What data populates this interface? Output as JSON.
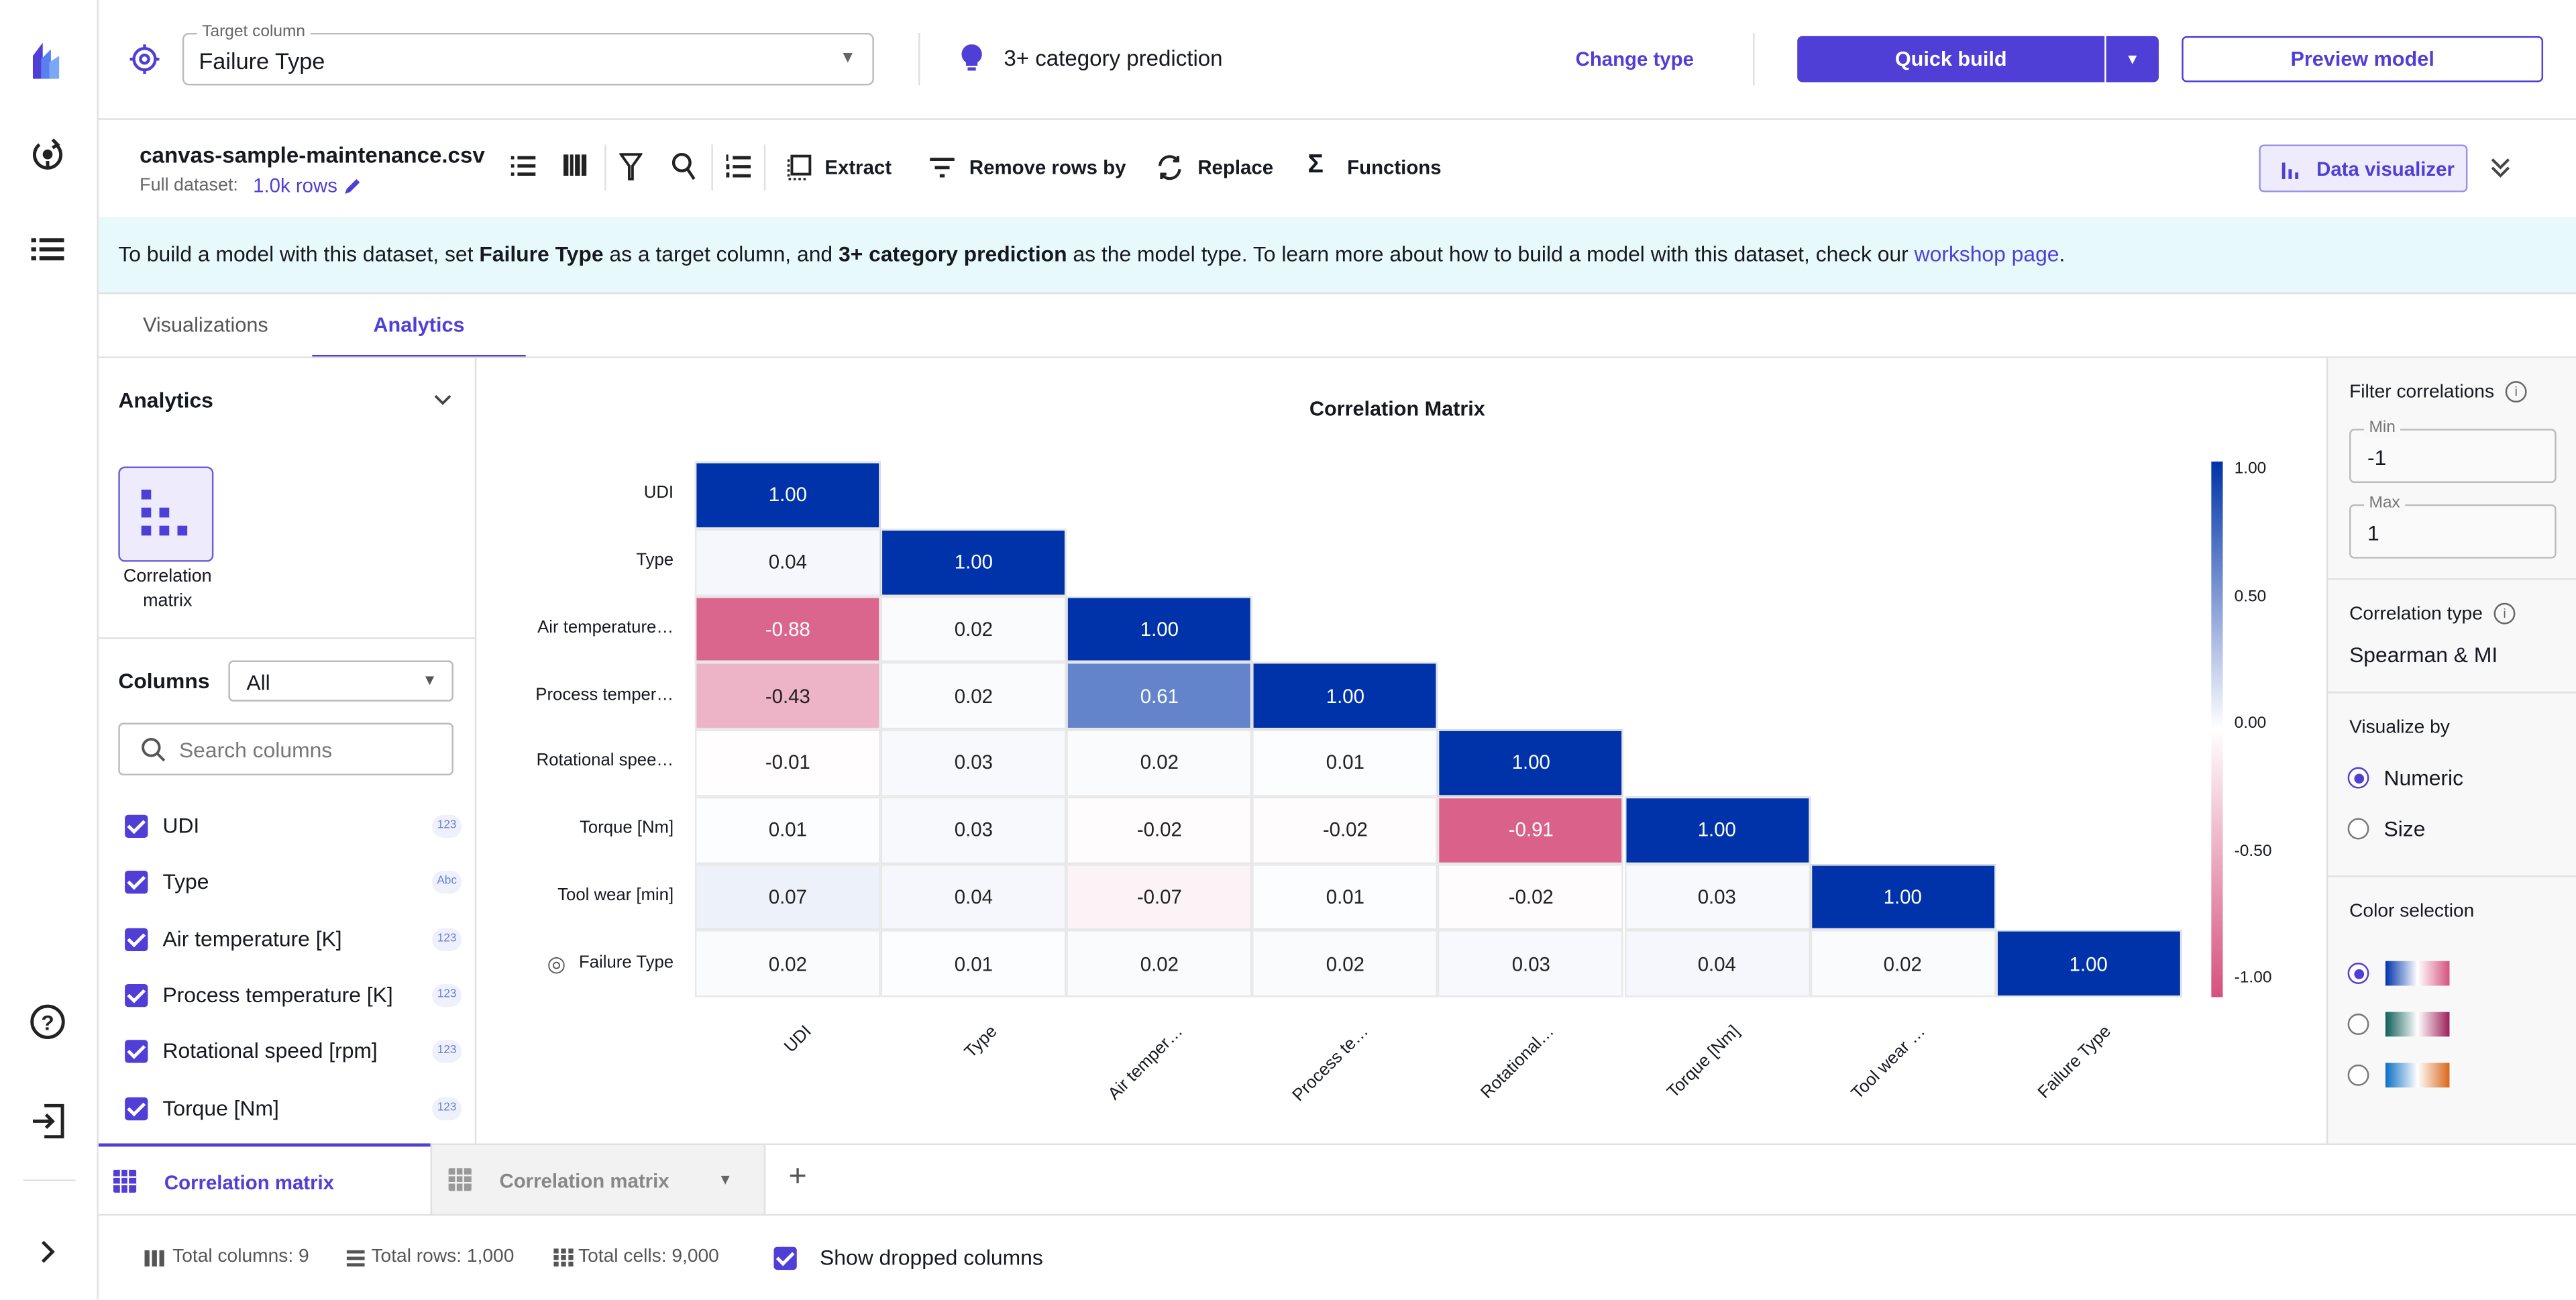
{
  "header": {
    "target_label": "Target column",
    "target_value": "Failure Type",
    "model_type": "3+ category prediction",
    "change_type": "Change type",
    "quick_build": "Quick build",
    "preview_model": "Preview model"
  },
  "toolbar": {
    "filename": "canvas-sample-maintenance.csv",
    "dataset_label": "Full dataset:",
    "rows_link": "1.0k rows",
    "extract": "Extract",
    "remove_rows": "Remove rows by",
    "replace": "Replace",
    "functions": "Functions",
    "data_visualizer": "Data visualizer"
  },
  "banner": {
    "p1": "To build a model with this dataset, set ",
    "b1": "Failure Type",
    "p2": " as a target column, and ",
    "b2": "3+ category prediction",
    "p3": " as the model type. To learn more about how to build a model with this dataset, check our ",
    "link": "workshop page",
    "p4": "."
  },
  "tabs": [
    {
      "label": "Visualizations"
    },
    {
      "label": "Analytics",
      "active": true
    }
  ],
  "left_panel": {
    "title": "Analytics",
    "card_label": "Correlation matrix",
    "columns_label": "Columns",
    "columns_filter": "All",
    "search_placeholder": "Search columns",
    "columns": [
      {
        "name": "UDI",
        "type": "123"
      },
      {
        "name": "Type",
        "type": "Abc"
      },
      {
        "name": "Air temperature [K]",
        "type": "123"
      },
      {
        "name": "Process temperature [K]",
        "type": "123"
      },
      {
        "name": "Rotational speed [rpm]",
        "type": "123"
      },
      {
        "name": "Torque [Nm]",
        "type": "123"
      }
    ]
  },
  "right_panel": {
    "filter_title": "Filter correlations",
    "min_label": "Min",
    "min_value": "-1",
    "max_label": "Max",
    "max_value": "1",
    "corr_type_title": "Correlation type",
    "corr_type_value": "Spearman & MI",
    "visualize_title": "Visualize by",
    "visualize_options": [
      "Numeric",
      "Size"
    ],
    "visualize_selected": "Numeric",
    "color_title": "Color selection",
    "color_schemes": [
      [
        "#0033aa",
        "#ffffff",
        "#d6517d"
      ],
      [
        "#0f5e58",
        "#ffffff",
        "#9c1f5a"
      ],
      [
        "#0b6fc4",
        "#ffffff",
        "#d9661a"
      ]
    ],
    "color_selected": 0
  },
  "chart_data": {
    "type": "heatmap",
    "title": "Correlation Matrix",
    "row_labels": [
      "UDI",
      "Type",
      "Air temperature…",
      "Process temper…",
      "Rotational spee…",
      "Torque [Nm]",
      "Tool wear [min]",
      "Failure Type"
    ],
    "col_labels": [
      "UDI",
      "Type",
      "Air temper…",
      "Process te…",
      "Rotational…",
      "Torque [Nm]",
      "Tool wear …",
      "Failure Type"
    ],
    "values": [
      [
        1.0
      ],
      [
        0.04,
        1.0
      ],
      [
        -0.88,
        0.02,
        1.0
      ],
      [
        -0.43,
        0.02,
        0.61,
        1.0
      ],
      [
        -0.01,
        0.03,
        0.02,
        0.01,
        1.0
      ],
      [
        0.01,
        0.03,
        -0.02,
        -0.02,
        -0.91,
        1.0
      ],
      [
        0.07,
        0.04,
        -0.07,
        0.01,
        -0.02,
        0.03,
        1.0
      ],
      [
        0.02,
        0.01,
        0.02,
        0.02,
        0.03,
        0.04,
        0.02,
        1.0
      ]
    ],
    "colorbar_ticks": [
      "1.00",
      "0.50",
      "0.00",
      "-0.50",
      "-1.00"
    ],
    "range": [
      -1,
      1
    ],
    "colors": {
      "positive": "#0033aa",
      "zero": "#ffffff",
      "negative": "#d6517d"
    }
  },
  "bottom_tabs": [
    {
      "label": "Correlation matrix",
      "active": true
    },
    {
      "label": "Correlation matrix"
    }
  ],
  "footer": {
    "total_columns": "Total columns: 9",
    "total_rows": "Total rows: 1,000",
    "total_cells": "Total cells: 9,000",
    "show_dropped": "Show dropped columns"
  }
}
